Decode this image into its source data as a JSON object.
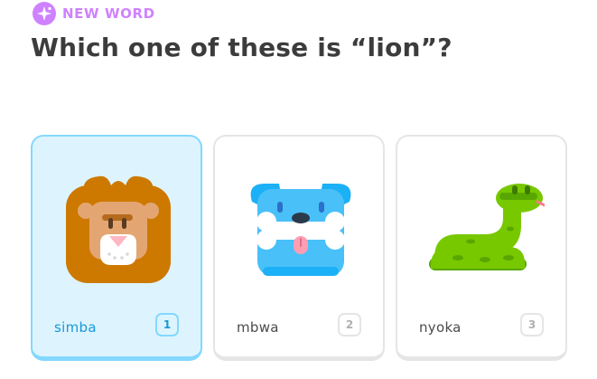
{
  "badge": {
    "label": "NEW WORD",
    "icon": "new-word-icon",
    "color": "#ce82ff"
  },
  "question": "Which one of these is “lion”?",
  "options": [
    {
      "label": "simba",
      "key": "1",
      "icon": "lion-icon",
      "selected": true
    },
    {
      "label": "mbwa",
      "key": "2",
      "icon": "dog-icon",
      "selected": false
    },
    {
      "label": "nyoka",
      "key": "3",
      "icon": "snake-icon",
      "selected": false
    }
  ],
  "colors": {
    "selected_background": "#ddf4ff",
    "selected_border": "#84d8ff",
    "selected_text": "#1899d6",
    "card_border": "#e5e5e5",
    "text": "#3c3c3c"
  }
}
